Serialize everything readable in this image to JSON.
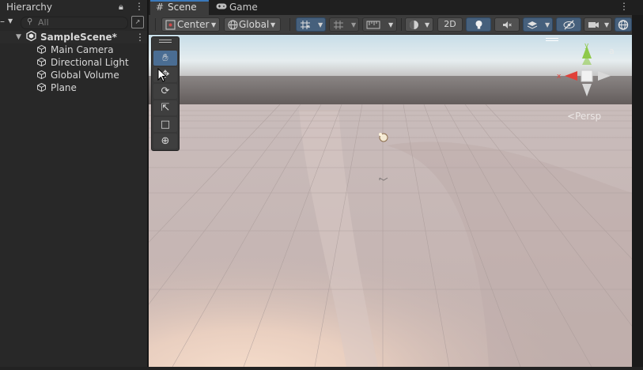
{
  "hierarchy": {
    "title": "Hierarchy",
    "search_placeholder": "All",
    "scene": {
      "name": "SampleScene*"
    },
    "objects": [
      {
        "name": "Main Camera"
      },
      {
        "name": "Directional Light"
      },
      {
        "name": "Global Volume"
      },
      {
        "name": "Plane"
      }
    ]
  },
  "tabs": [
    {
      "label": "Scene",
      "active": true
    },
    {
      "label": "Game",
      "active": false
    }
  ],
  "toolbar": {
    "pivot_mode": "Center",
    "pivot_rotation": "Global",
    "mode_2d": "2D"
  },
  "viewport": {
    "projection_label": "Persp",
    "gizmo_axes": {
      "x": "x",
      "y": "y"
    }
  },
  "tool_palette": [
    "hand-tool",
    "move-tool",
    "rotate-tool",
    "scale-tool",
    "rect-tool",
    "transform-tool"
  ],
  "colors": {
    "accent": "#3a79bb",
    "selected_tool": "#4a6d93",
    "axis_x": "#e0413a",
    "axis_y": "#8ec94a"
  }
}
